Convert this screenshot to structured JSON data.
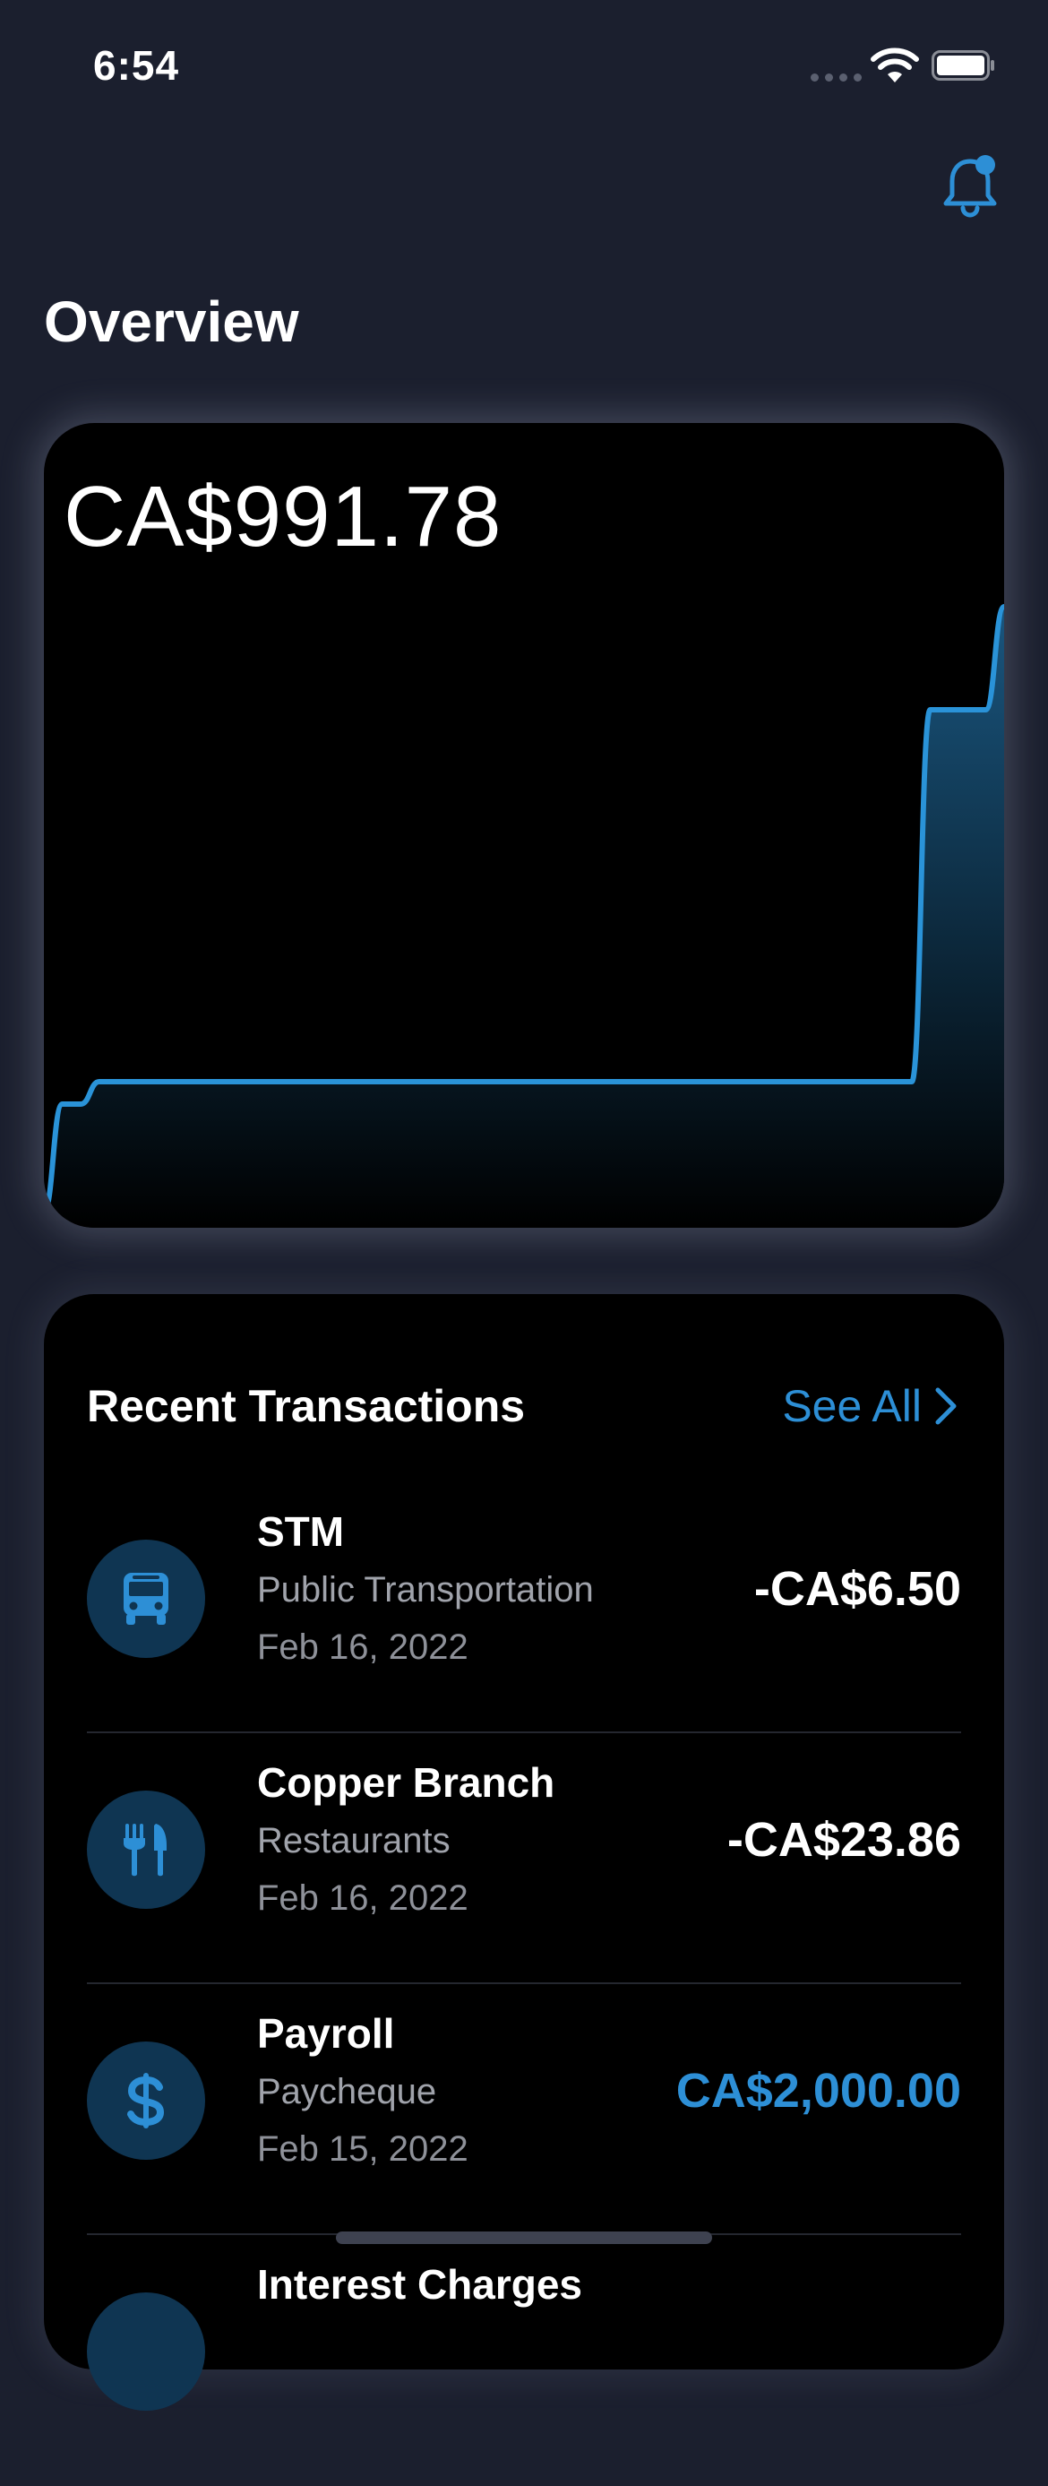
{
  "status": {
    "time": "6:54"
  },
  "header": {
    "title": "Overview"
  },
  "balance": {
    "amount": "CA$991.78"
  },
  "chart_data": {
    "type": "area",
    "points": [
      0,
      120,
      120,
      145,
      145,
      145,
      145,
      145,
      145,
      145,
      145,
      145,
      145,
      145,
      145,
      145,
      145,
      145,
      145,
      145,
      145,
      145,
      145,
      145,
      145,
      145,
      145,
      145,
      145,
      145,
      145,
      145,
      145,
      145,
      145,
      145,
      145,
      145,
      145,
      145,
      145,
      145,
      145,
      145,
      145,
      145,
      145,
      145,
      560,
      560,
      560,
      560,
      675
    ],
    "colors": {
      "line": "#2a93d8",
      "fill_top": "#1b5a85",
      "fill_bottom": "#000000"
    }
  },
  "transactions": {
    "title": "Recent Transactions",
    "see_all": "See All",
    "items": [
      {
        "name": "STM",
        "category": "Public Transportation",
        "date": "Feb 16, 2022",
        "amount": "-CA$6.50",
        "icon": "bus-icon",
        "positive": false
      },
      {
        "name": "Copper Branch",
        "category": "Restaurants",
        "date": "Feb 16, 2022",
        "amount": "-CA$23.86",
        "icon": "fork-knife-icon",
        "positive": false
      },
      {
        "name": "Payroll",
        "category": "Paycheque",
        "date": "Feb 15, 2022",
        "amount": "CA$2,000.00",
        "icon": "dollar-icon",
        "positive": true
      },
      {
        "name": "Interest Charges",
        "category": "",
        "date": "",
        "amount": "",
        "icon": "",
        "positive": false
      }
    ]
  },
  "colors": {
    "accent": "#2d8fd6",
    "background": "#1b1f2e",
    "card": "#000000",
    "icon_bg": "#0f3552"
  }
}
